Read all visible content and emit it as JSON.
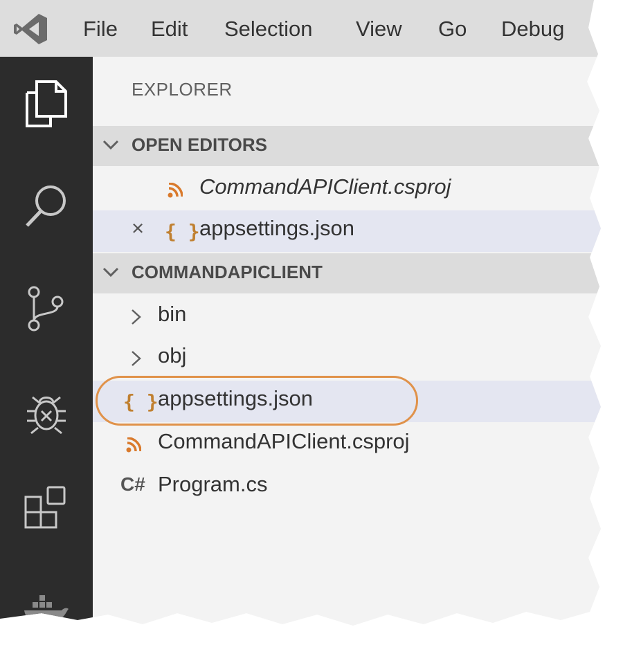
{
  "menu": {
    "items": [
      "File",
      "Edit",
      "Selection",
      "View",
      "Go",
      "Debug"
    ]
  },
  "activity_bar": {
    "icons": [
      "explorer-icon",
      "search-icon",
      "source-control-icon",
      "debug-icon",
      "extensions-icon",
      "docker-icon"
    ]
  },
  "explorer": {
    "title": "EXPLORER",
    "open_editors": {
      "header": "OPEN EDITORS",
      "items": [
        {
          "label": "CommandAPIClient.csproj",
          "icon": "rss-icon",
          "italic": true
        },
        {
          "label": "appsettings.json",
          "icon": "json-icon",
          "close": "×"
        }
      ]
    },
    "project": {
      "header": "COMMANDAPICLIENT",
      "items": [
        {
          "label": "bin",
          "type": "folder"
        },
        {
          "label": "obj",
          "type": "folder"
        },
        {
          "label": "appsettings.json",
          "icon": "json-icon"
        },
        {
          "label": "CommandAPIClient.csproj",
          "icon": "rss-icon"
        },
        {
          "label": "Program.cs",
          "icon": "csharp-icon"
        }
      ]
    },
    "json_glyph": "{ }",
    "cs_glyph": "C#"
  },
  "colors": {
    "activity_bar": "#2c2c2c",
    "sidebar": "#f3f3f3",
    "section_header": "#dcdcdc",
    "selection": "#e4e6f1",
    "highlight": "#e0924a",
    "vs_blue": "#3c7ec9"
  }
}
